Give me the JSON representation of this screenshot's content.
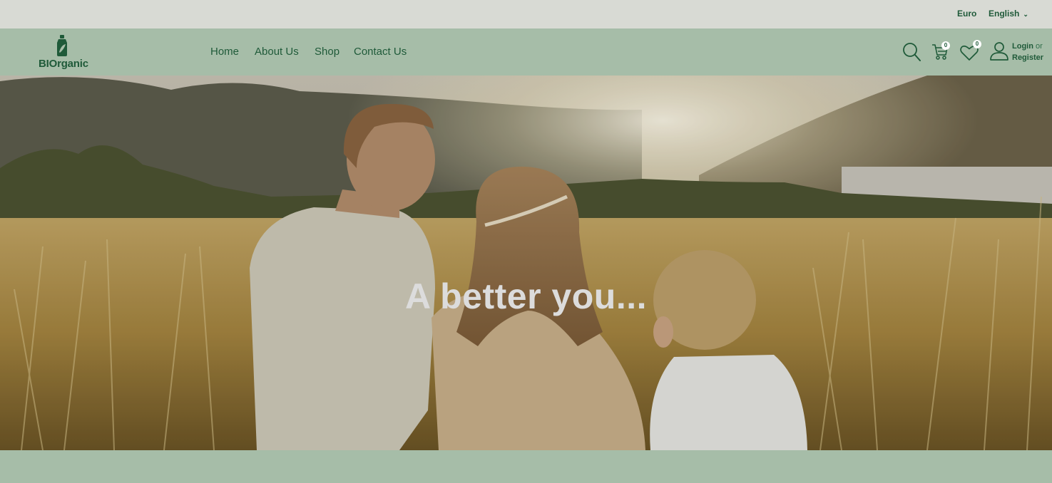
{
  "topbar": {
    "currency": "Euro",
    "language": "English"
  },
  "header": {
    "logo_text": "BIOrganic",
    "nav": [
      {
        "label": "Home"
      },
      {
        "label": "About Us"
      },
      {
        "label": "Shop"
      },
      {
        "label": "Contact Us"
      }
    ],
    "cart_count": "0",
    "wishlist_count": "0",
    "login_label": "Login",
    "or_label": "or",
    "register_label": "Register"
  },
  "hero": {
    "headline": "A better you..."
  },
  "colors": {
    "brand_green": "#1f5a39",
    "header_bg": "#a6bda8",
    "topbar_bg": "#d8dad4"
  },
  "icons": [
    "logo-bottle-icon",
    "chevron-down-icon",
    "search-icon",
    "cart-icon",
    "heart-icon",
    "user-icon"
  ]
}
